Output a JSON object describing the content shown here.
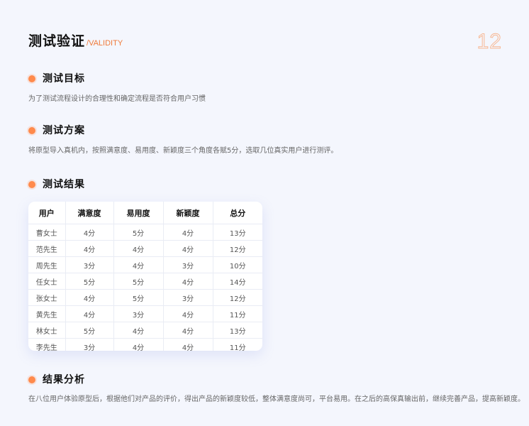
{
  "header": {
    "title": "测试验证",
    "subtitle": "/VALIDITY",
    "page_number": "12"
  },
  "sections": [
    {
      "title": "测试目标",
      "text": "为了测试流程设计的合理性和确定流程是否符合用户习惯"
    },
    {
      "title": "测试方案",
      "text": "将原型导入真机内，按照满意度、易用度、新颖度三个角度各赋5分，选取几位真实用户进行测评。"
    },
    {
      "title": "测试结果"
    },
    {
      "title": "结果分析",
      "text": "在八位用户体验原型后，根据他们对产品的评价，得出产品的新颖度较低，整体满意度尚可，平台易用。在之后的高保真输出前，继续完善产品，提高新颖度。"
    }
  ],
  "table": {
    "headers": [
      "用户",
      "满意度",
      "易用度",
      "新颖度",
      "总分"
    ],
    "rows": [
      [
        "曹女士",
        "4分",
        "5分",
        "4分",
        "13分"
      ],
      [
        "范先生",
        "4分",
        "4分",
        "4分",
        "12分"
      ],
      [
        "周先生",
        "3分",
        "4分",
        "3分",
        "10分"
      ],
      [
        "任女士",
        "5分",
        "5分",
        "4分",
        "14分"
      ],
      [
        "张女士",
        "4分",
        "5分",
        "3分",
        "12分"
      ],
      [
        "黄先生",
        "4分",
        "3分",
        "4分",
        "11分"
      ],
      [
        "林女士",
        "5分",
        "4分",
        "4分",
        "13分"
      ],
      [
        "李先生",
        "3分",
        "4分",
        "4分",
        "11分"
      ]
    ]
  },
  "colors": {
    "accent": "#ff8a4c",
    "background": "#f4f6fd"
  }
}
